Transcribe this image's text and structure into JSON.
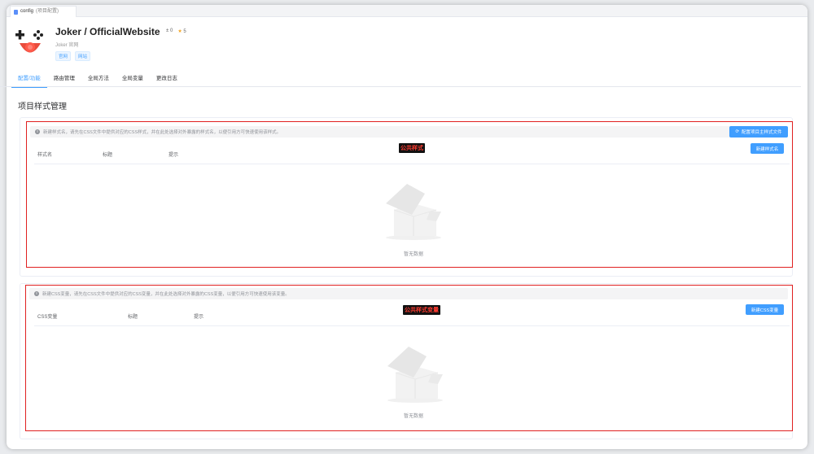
{
  "tab": {
    "name": "config",
    "sub": "(项目配置)"
  },
  "project": {
    "title": "Joker / OfficialWebsite",
    "forks": "0",
    "stars": "5",
    "subtitle": "Joker 官网",
    "tags": [
      "官网",
      "网站"
    ]
  },
  "nav": [
    "配置/功能",
    "路由管理",
    "全局方法",
    "全局变量",
    "更改日志"
  ],
  "page_title": "项目样式管理",
  "section1": {
    "alert": "新建样式名，请先在CSS文件中提供对应的CSS样式，并在此处选择对外暴露的样式名，以便引用方可快速使用该样式。",
    "main_button": "配置项目主样式文件",
    "columns": [
      "样式名",
      "标题",
      "提示"
    ],
    "new_button": "新建样式名",
    "label": "公共样式",
    "empty": "暂无数据"
  },
  "section2": {
    "alert": "新建CSS变量，请先在CSS文件中提供对应的CSS变量，并在此处选择对外暴露的CSS变量，以便引用方可快速使用该变量。",
    "columns": [
      "CSS变量",
      "标题",
      "提示"
    ],
    "new_button": "新建CSS变量",
    "label": "公共样式变量",
    "empty": "暂无数据"
  },
  "colors": {
    "accent": "#409eff",
    "highlight": "#e02020"
  }
}
